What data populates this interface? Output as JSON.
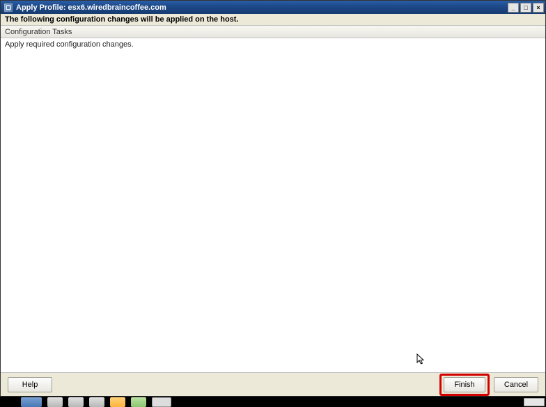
{
  "title": "Apply Profile: esx6.wiredbraincoffee.com",
  "subtitle": "The following configuration changes will be applied on the host.",
  "section_header": "Configuration Tasks",
  "tasks": [
    "Apply required configuration changes."
  ],
  "buttons": {
    "help": "Help",
    "finish": "Finish",
    "cancel": "Cancel"
  },
  "win_controls": {
    "minimize": "_",
    "maximize": "□",
    "close": "×"
  }
}
